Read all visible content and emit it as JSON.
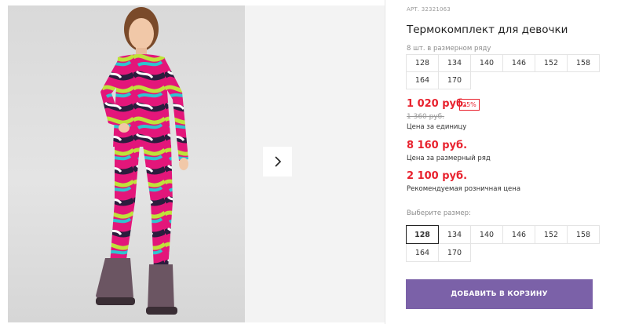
{
  "product": {
    "article": "АРТ. 32321063",
    "title": "Термокомплект для девочки"
  },
  "pack": {
    "hint": "8 шт. в размерном ряду",
    "sizes": [
      "128",
      "134",
      "140",
      "146",
      "152",
      "158",
      "164",
      "170"
    ]
  },
  "pricing": {
    "unit_price": "1 020 руб.",
    "discount_badge": "25%",
    "old_price": "1 360 руб.",
    "unit_label": "Цена за единицу",
    "row_price": "8 160 руб.",
    "row_label": "Цена за размерный ряд",
    "retail_price": "2 100 руб.",
    "retail_label": "Рекомендуемая розничная цена"
  },
  "size_select": {
    "hint": "Выберите размер:",
    "sizes": [
      "128",
      "134",
      "140",
      "146",
      "152",
      "158",
      "164",
      "170"
    ],
    "selected": "128"
  },
  "actions": {
    "add_to_cart": "ДОБАВИТЬ В КОРЗИНУ"
  },
  "colors": {
    "price_red": "#e8222e",
    "cart_button": "#7b61a8"
  },
  "icons": {
    "next": "chevron-right-icon"
  }
}
